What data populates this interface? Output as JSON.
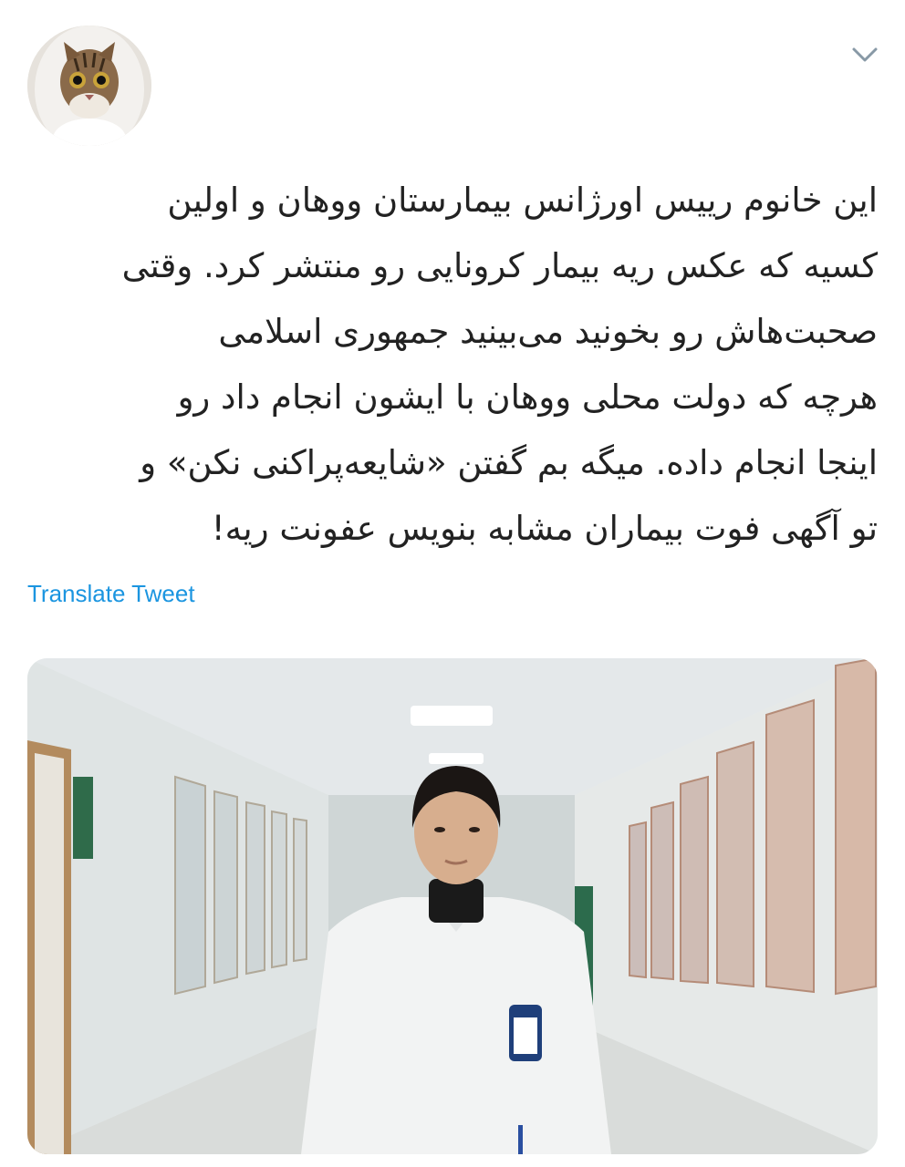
{
  "tweet": {
    "text_lines": [
      "این خانوم رییس اورژانس بیمارستان ووهان و اولین",
      "کسیه که عکس ریه بیمار کرونایی رو منتشر کرد. وقتی",
      "صحبت‌هاش رو بخونید می‌بینید جمهوری اسلامی",
      "هرچه که دولت محلی ووهان با ایشون انجام داد رو",
      "اینجا انجام داده. میگه بم گفتن «شایعه‌پراکنی نکن» و",
      "تو آگهی فوت بیماران مشابه بنویس عفونت ریه!"
    ],
    "translate_label": "Translate Tweet"
  },
  "icons": {
    "avatar": "cat-avatar-icon",
    "menu": "chevron-down-icon"
  },
  "colors": {
    "text": "#222222",
    "link": "#1b95e0",
    "chevron": "#8899a6"
  }
}
